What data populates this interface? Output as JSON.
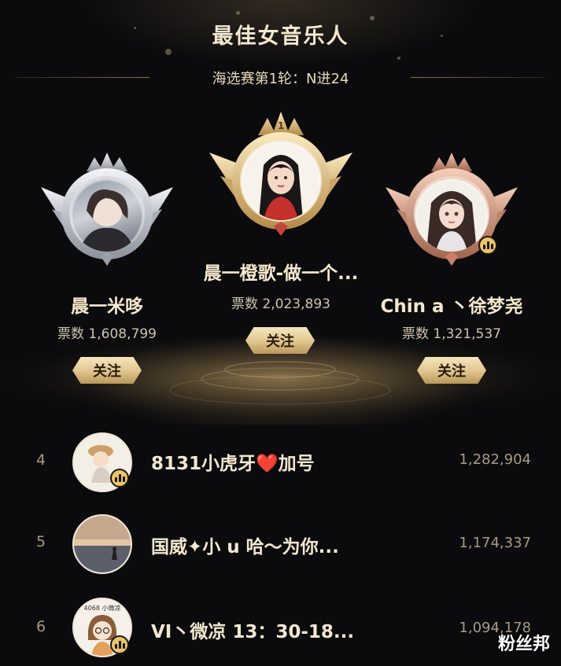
{
  "header": {
    "title": "最佳女音乐人",
    "subtitle": "海选赛第1轮：N进24"
  },
  "podium": [
    {
      "rank": "1",
      "name": "晨一橙歌-做一个...",
      "votes_label": "票数 2,023,893",
      "follow_label": "关注",
      "medal": "gold",
      "avatar_icon": "anime-girl-red-dress"
    },
    {
      "rank": "2",
      "name": "晨一米哆",
      "votes_label": "票数 1,608,799",
      "follow_label": "关注",
      "medal": "silver",
      "avatar_icon": "woman-photo-portrait"
    },
    {
      "rank": "3",
      "name": "Chin a 丶徐梦尧",
      "votes_label": "票数 1,321,537",
      "follow_label": "关注",
      "medal": "bronze",
      "avatar_icon": "anime-girl-dark-hair"
    }
  ],
  "list": [
    {
      "rank": "4",
      "name": "8131小虎牙❤️加号",
      "votes": "1,282,904",
      "avatar_icon": "cartoon-girl-hat"
    },
    {
      "rank": "5",
      "name": "国威✦小 u 哈～为你...",
      "votes": "1,174,337",
      "avatar_icon": "sunset-sea-silhouette"
    },
    {
      "rank": "6",
      "name": "VI丶微凉 13：30-18...",
      "votes": "1,094,178",
      "avatar_icon": "cartoon-girl-glasses",
      "avatar_text": "4068 小微凉"
    }
  ],
  "watermark": "粉丝邦",
  "colors": {
    "background": "#0b0b0d",
    "gold": "#e0c48d",
    "silver": "#c9ccd3",
    "bronze": "#d79a7e",
    "audio_badge": "#e9c46a"
  }
}
